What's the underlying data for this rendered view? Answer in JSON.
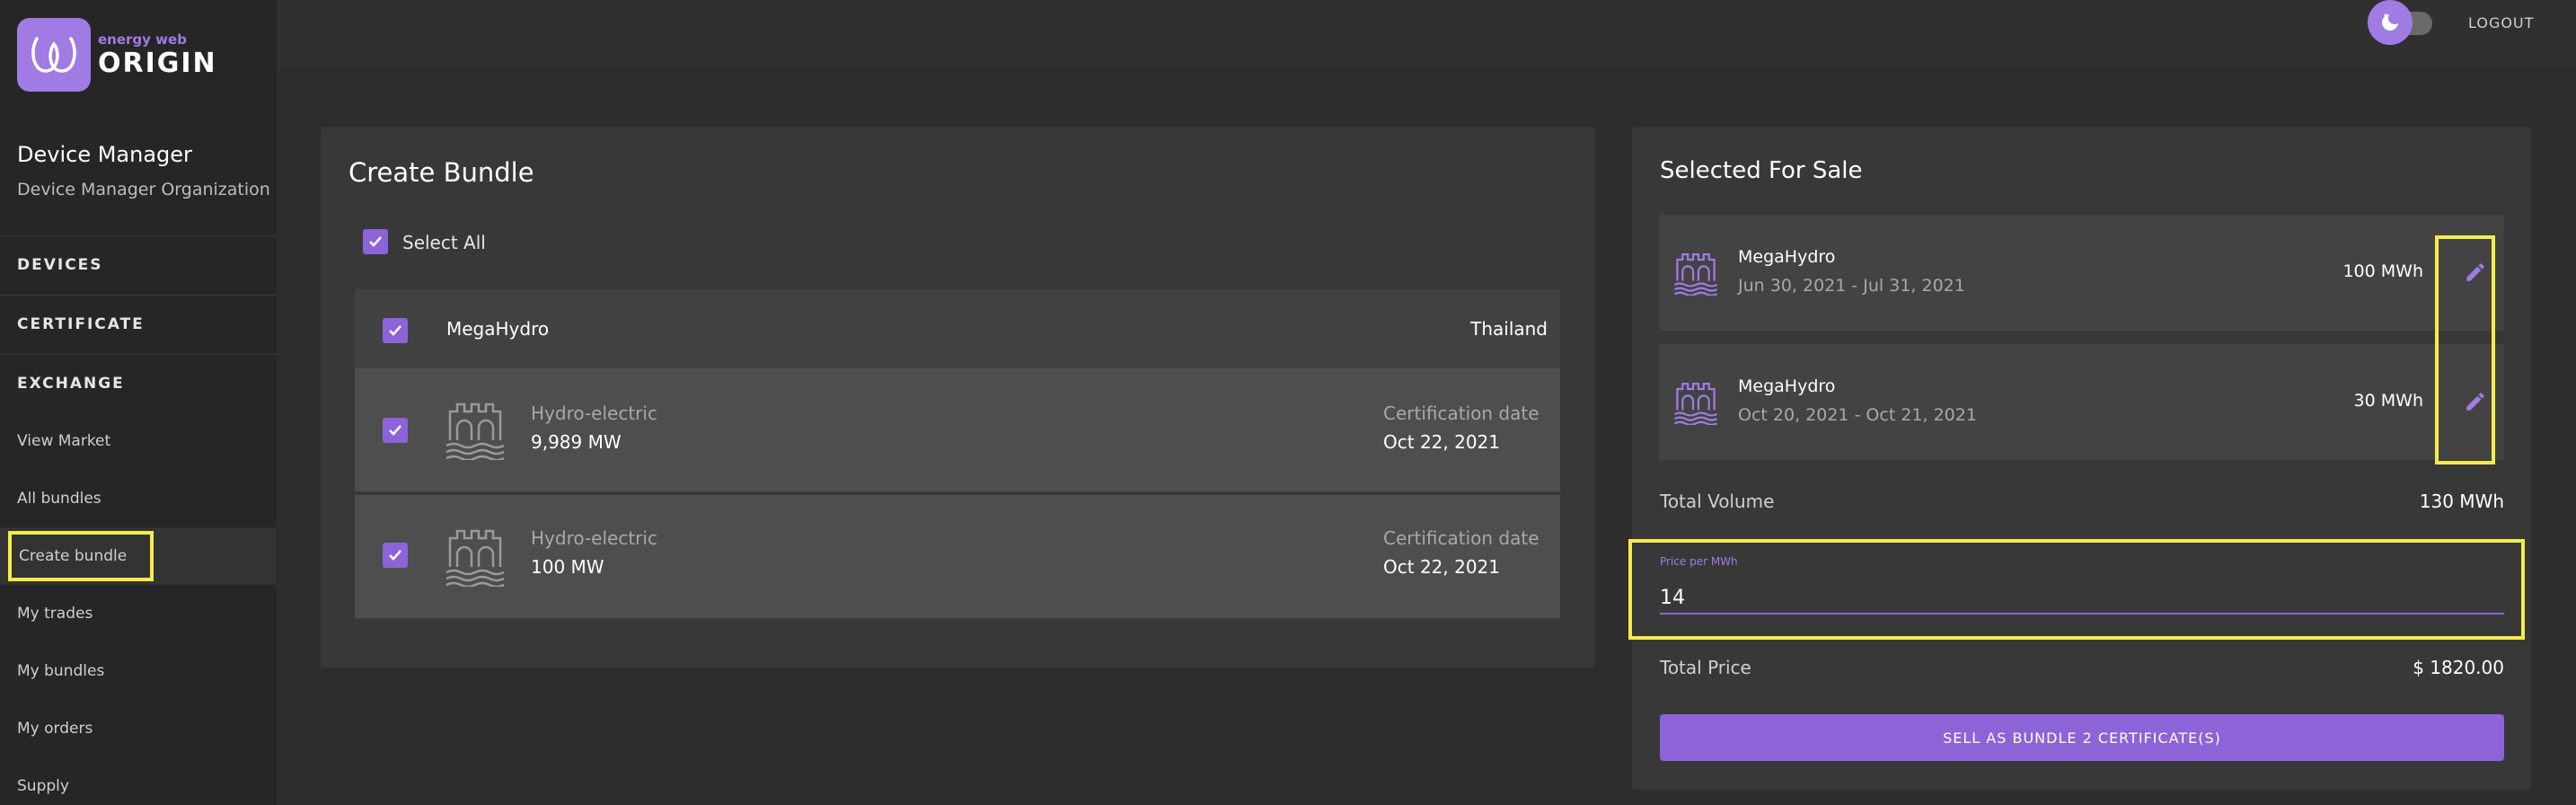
{
  "brand": {
    "top": "energy web",
    "name": "ORIGIN"
  },
  "user": {
    "name": "Device Manager",
    "organization": "Device Manager Organization"
  },
  "sidebar": {
    "sections": [
      "DEVICES",
      "CERTIFICATE",
      "EXCHANGE"
    ],
    "items": [
      "View Market",
      "All bundles",
      "Create bundle",
      "My trades",
      "My bundles",
      "My orders",
      "Supply"
    ],
    "active_item": "Create bundle"
  },
  "topbar": {
    "logout": "LOGOUT"
  },
  "create_bundle": {
    "title": "Create Bundle",
    "select_all": "Select All",
    "device": {
      "name": "MegaHydro",
      "country": "Thailand"
    },
    "rows": [
      {
        "type": "Hydro-electric",
        "volume": "9,989 MW",
        "date_label": "Certification date",
        "date": "Oct 22, 2021"
      },
      {
        "type": "Hydro-electric",
        "volume": "100 MW",
        "date_label": "Certification date",
        "date": "Oct 22, 2021"
      }
    ]
  },
  "selected_for_sale": {
    "title": "Selected For Sale",
    "items": [
      {
        "name": "MegaHydro",
        "period": "Jun 30, 2021 - Jul 31, 2021",
        "volume": "100 MWh"
      },
      {
        "name": "MegaHydro",
        "period": "Oct 20, 2021 - Oct 21, 2021",
        "volume": "30 MWh"
      }
    ],
    "total_volume_label": "Total Volume",
    "total_volume": "130 MWh",
    "price_label": "Price per MWh",
    "price_value": "14",
    "total_price_label": "Total Price",
    "total_price": "$ 1820.00",
    "sell_button": "SELL AS BUNDLE 2 CERTIFICATE(S)"
  },
  "colors": {
    "accent": "#8d63d8",
    "highlight": "#f4ec4b",
    "background": "#2d2d2d",
    "card": "#383838"
  },
  "icons": [
    "logo-icon",
    "theme-toggle-icon",
    "checkbox-check-icon",
    "hydro-dam-icon",
    "edit-pencil-icon"
  ]
}
